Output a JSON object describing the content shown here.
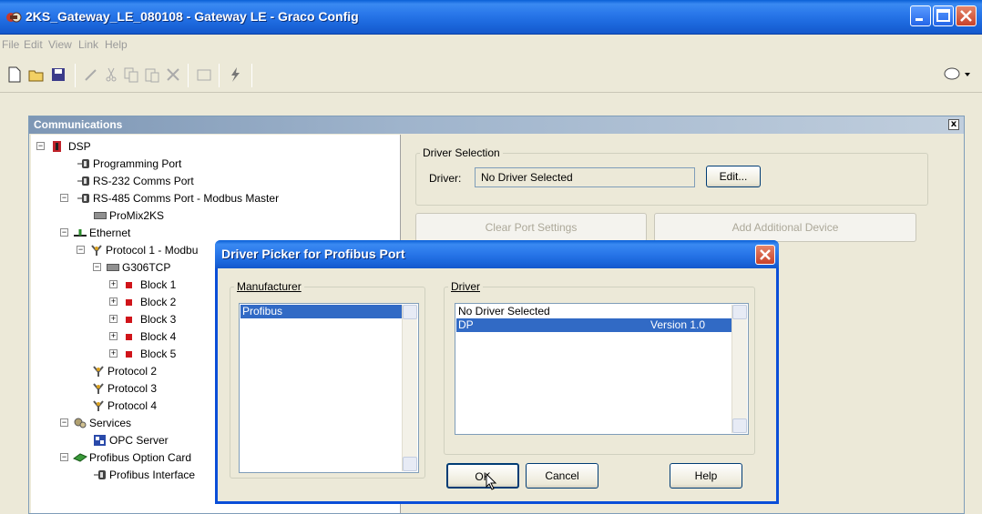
{
  "window": {
    "title": "2KS_Gateway_LE_080108 - Gateway LE - Graco Config"
  },
  "menu": [
    "File",
    "Edit",
    "View",
    "Link",
    "Help"
  ],
  "toolbar": {
    "icons": [
      "new-icon",
      "open-icon",
      "save-icon",
      "pencil-icon",
      "cut-icon",
      "copy-icon",
      "paste-icon",
      "delete-icon",
      "window-icon",
      "lightning-icon",
      "speech-bubble-icon"
    ]
  },
  "comms": {
    "title": "Communications",
    "close_label": "x",
    "tree": [
      {
        "label": "DSP"
      },
      {
        "label": "Programming Port"
      },
      {
        "label": "RS-232 Comms Port"
      },
      {
        "label": "RS-485 Comms Port - Modbus Master"
      },
      {
        "label": "ProMix2KS"
      },
      {
        "label": "Ethernet"
      },
      {
        "label": "Protocol 1 - Modbu"
      },
      {
        "label": "G306TCP"
      },
      {
        "label": "Block 1"
      },
      {
        "label": "Block 2"
      },
      {
        "label": "Block 3"
      },
      {
        "label": "Block 4"
      },
      {
        "label": "Block 5"
      },
      {
        "label": "Protocol 2"
      },
      {
        "label": "Protocol 3"
      },
      {
        "label": "Protocol 4"
      },
      {
        "label": "Services"
      },
      {
        "label": "OPC Server"
      },
      {
        "label": "Profibus Option Card"
      },
      {
        "label": "Profibus Interface"
      }
    ],
    "driver_selection": {
      "group_title": "Driver Selection",
      "driver_label": "Driver:",
      "driver_value": "No Driver Selected",
      "edit_button": "Edit..."
    },
    "clear_port_button": "Clear Port Settings",
    "add_device_button": "Add Additional Device"
  },
  "dialog": {
    "title": "Driver Picker for Profibus Port",
    "manufacturer_group": "Manufacturer",
    "manufacturers": [
      {
        "name": "Profibus",
        "selected": true
      }
    ],
    "driver_group": "Driver",
    "drivers": [
      {
        "name": "No Driver Selected",
        "version": "",
        "selected": false
      },
      {
        "name": "DP",
        "version": "Version 1.0",
        "selected": true
      }
    ],
    "ok_button": "OK",
    "cancel_button": "Cancel",
    "help_button": "Help"
  }
}
